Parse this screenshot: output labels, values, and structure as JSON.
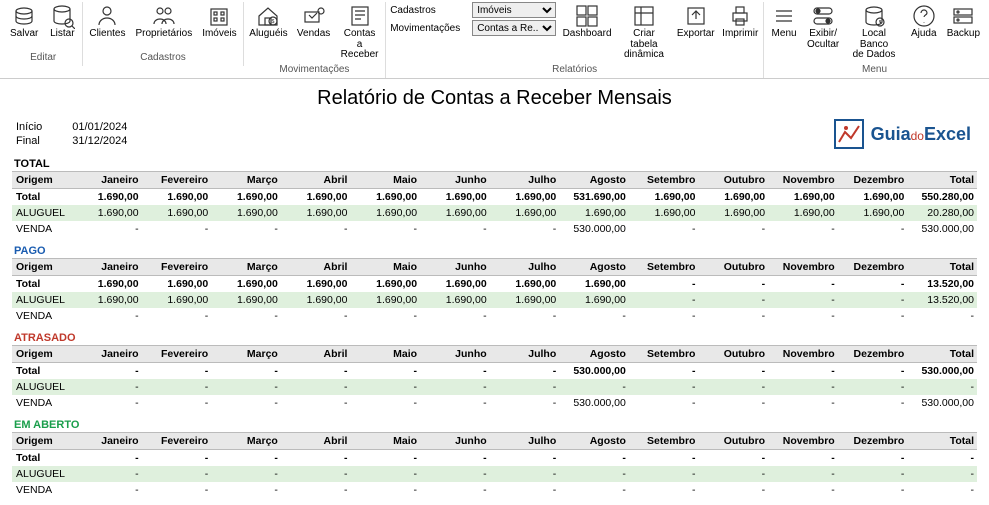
{
  "ribbon": {
    "groups": [
      {
        "caption": "Editar",
        "buttons": [
          {
            "name": "salvar",
            "label": "Salvar"
          },
          {
            "name": "listar",
            "label": "Listar"
          }
        ]
      },
      {
        "caption": "Cadastros",
        "buttons": [
          {
            "name": "clientes",
            "label": "Clientes"
          },
          {
            "name": "proprietarios",
            "label": "Proprietários"
          },
          {
            "name": "imoveis",
            "label": "Imóveis"
          }
        ]
      },
      {
        "caption": "Movimentações",
        "buttons": [
          {
            "name": "alugueis",
            "label": "Aluguéis"
          },
          {
            "name": "vendas",
            "label": "Vendas"
          },
          {
            "name": "contas-receber",
            "label": "Contas a\nReceber"
          }
        ]
      },
      {
        "caption": "Relatórios",
        "stack": [
          {
            "label": "Cadastros",
            "select": "Imóveis"
          },
          {
            "label": "Movimentações",
            "select": "Contas a Re..."
          }
        ],
        "buttons": [
          {
            "name": "dashboard",
            "label": "Dashboard"
          },
          {
            "name": "criar-tabela-dinamica",
            "label": "Criar tabela\ndinâmica"
          },
          {
            "name": "exportar",
            "label": "Exportar"
          },
          {
            "name": "imprimir",
            "label": "Imprimir"
          }
        ]
      },
      {
        "caption": "Menu",
        "buttons": [
          {
            "name": "menu",
            "label": "Menu"
          },
          {
            "name": "exibir-ocultar",
            "label": "Exibir/\nOcultar"
          },
          {
            "name": "local-banco-dados",
            "label": "Local Banco\nde Dados"
          },
          {
            "name": "ajuda",
            "label": "Ajuda"
          },
          {
            "name": "backup",
            "label": "Backup"
          }
        ]
      }
    ]
  },
  "title": "Relatório de Contas a Receber Mensais",
  "dates": {
    "inicioLabel": "Início",
    "inicio": "01/01/2024",
    "finalLabel": "Final",
    "final": "31/12/2024"
  },
  "logo": {
    "t1": "Guia",
    "t2": "do",
    "t3": "Excel"
  },
  "months": [
    "Janeiro",
    "Fevereiro",
    "Março",
    "Abril",
    "Maio",
    "Junho",
    "Julho",
    "Agosto",
    "Setembro",
    "Outubro",
    "Novembro",
    "Dezembro",
    "Total"
  ],
  "origemHeader": "Origem",
  "sections": [
    {
      "key": "total",
      "title": "TOTAL",
      "rows": [
        {
          "label": "Total",
          "cls": "total",
          "v": [
            "1.690,00",
            "1.690,00",
            "1.690,00",
            "1.690,00",
            "1.690,00",
            "1.690,00",
            "1.690,00",
            "531.690,00",
            "1.690,00",
            "1.690,00",
            "1.690,00",
            "1.690,00",
            "550.280,00"
          ]
        },
        {
          "label": "ALUGUEL",
          "cls": "aluguel",
          "v": [
            "1.690,00",
            "1.690,00",
            "1.690,00",
            "1.690,00",
            "1.690,00",
            "1.690,00",
            "1.690,00",
            "1.690,00",
            "1.690,00",
            "1.690,00",
            "1.690,00",
            "1.690,00",
            "20.280,00"
          ]
        },
        {
          "label": "VENDA",
          "cls": "",
          "v": [
            "-",
            "-",
            "-",
            "-",
            "-",
            "-",
            "-",
            "530.000,00",
            "-",
            "-",
            "-",
            "-",
            "530.000,00"
          ]
        }
      ]
    },
    {
      "key": "pago",
      "title": "PAGO",
      "rows": [
        {
          "label": "Total",
          "cls": "total",
          "v": [
            "1.690,00",
            "1.690,00",
            "1.690,00",
            "1.690,00",
            "1.690,00",
            "1.690,00",
            "1.690,00",
            "1.690,00",
            "-",
            "-",
            "-",
            "-",
            "13.520,00"
          ]
        },
        {
          "label": "ALUGUEL",
          "cls": "aluguel",
          "v": [
            "1.690,00",
            "1.690,00",
            "1.690,00",
            "1.690,00",
            "1.690,00",
            "1.690,00",
            "1.690,00",
            "1.690,00",
            "-",
            "-",
            "-",
            "-",
            "13.520,00"
          ]
        },
        {
          "label": "VENDA",
          "cls": "",
          "v": [
            "-",
            "-",
            "-",
            "-",
            "-",
            "-",
            "-",
            "-",
            "-",
            "-",
            "-",
            "-",
            "-"
          ]
        }
      ]
    },
    {
      "key": "atrasado",
      "title": "ATRASADO",
      "rows": [
        {
          "label": "Total",
          "cls": "total",
          "v": [
            "-",
            "-",
            "-",
            "-",
            "-",
            "-",
            "-",
            "530.000,00",
            "-",
            "-",
            "-",
            "-",
            "530.000,00"
          ]
        },
        {
          "label": "ALUGUEL",
          "cls": "aluguel",
          "v": [
            "-",
            "-",
            "-",
            "-",
            "-",
            "-",
            "-",
            "-",
            "-",
            "-",
            "-",
            "-",
            "-"
          ]
        },
        {
          "label": "VENDA",
          "cls": "",
          "v": [
            "-",
            "-",
            "-",
            "-",
            "-",
            "-",
            "-",
            "530.000,00",
            "-",
            "-",
            "-",
            "-",
            "530.000,00"
          ]
        }
      ]
    },
    {
      "key": "aberto",
      "title": "EM ABERTO",
      "rows": [
        {
          "label": "Total",
          "cls": "total",
          "v": [
            "-",
            "-",
            "-",
            "-",
            "-",
            "-",
            "-",
            "-",
            "-",
            "-",
            "-",
            "-",
            "-"
          ]
        },
        {
          "label": "ALUGUEL",
          "cls": "aluguel",
          "v": [
            "-",
            "-",
            "-",
            "-",
            "-",
            "-",
            "-",
            "-",
            "-",
            "-",
            "-",
            "-",
            "-"
          ]
        },
        {
          "label": "VENDA",
          "cls": "",
          "v": [
            "-",
            "-",
            "-",
            "-",
            "-",
            "-",
            "-",
            "-",
            "-",
            "-",
            "-",
            "-",
            "-"
          ]
        }
      ]
    }
  ]
}
